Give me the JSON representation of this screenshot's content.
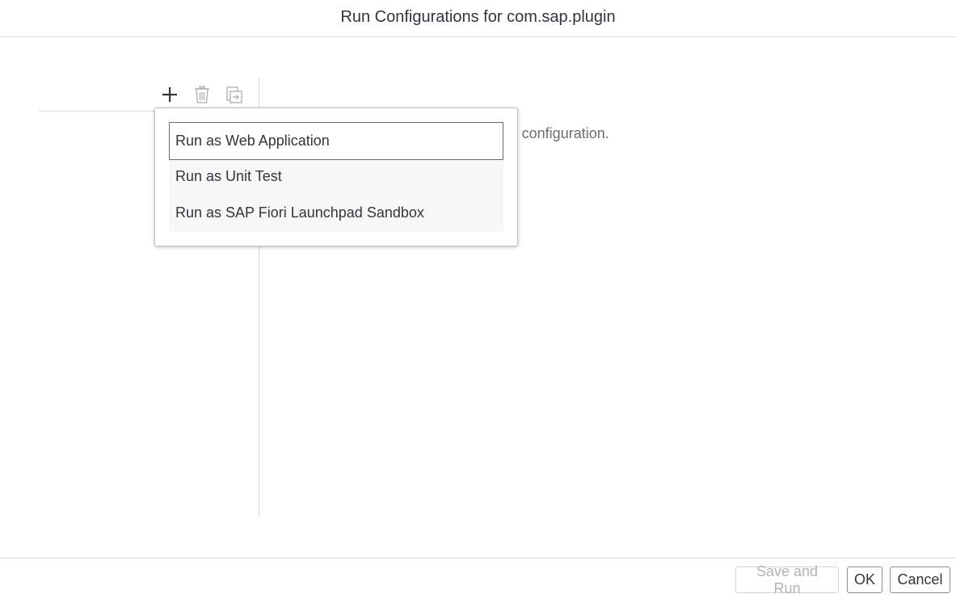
{
  "dialog": {
    "title": "Run Configurations for com.sap.plugin"
  },
  "toolbar": {
    "icons": [
      "plus-icon",
      "trash-icon",
      "export-icon"
    ]
  },
  "content": {
    "hint": "guration or click + to create a new run configuration."
  },
  "menu": {
    "items": [
      {
        "label": "Run as Web Application"
      },
      {
        "label": "Run as Unit Test"
      },
      {
        "label": "Run as SAP Fiori Launchpad Sandbox"
      }
    ]
  },
  "footer": {
    "save_and_run": "Save and Run",
    "ok": "OK",
    "cancel": "Cancel"
  },
  "colors": {
    "text": "#32363a",
    "muted": "#6a6d70",
    "border": "#d9d9d9",
    "disabled": "#b0b3b6"
  }
}
